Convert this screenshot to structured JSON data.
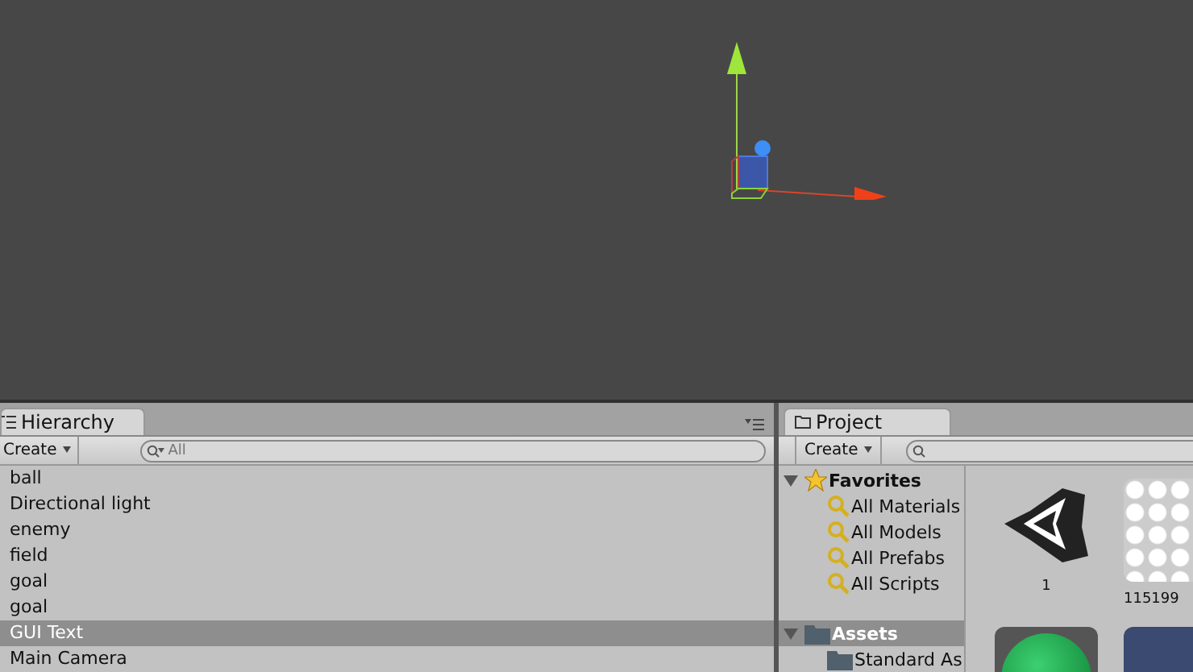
{
  "hierarchy": {
    "tab": "Hierarchy",
    "create": "Create",
    "search": {
      "placeholder": "All"
    },
    "rows": [
      {
        "label": "ball",
        "selected": false
      },
      {
        "label": "Directional light",
        "selected": false
      },
      {
        "label": "enemy",
        "selected": false
      },
      {
        "label": "field",
        "selected": false
      },
      {
        "label": "goal",
        "selected": false
      },
      {
        "label": "goal",
        "selected": false
      },
      {
        "label": "GUI Text",
        "selected": true
      },
      {
        "label": "Main Camera",
        "selected": false
      }
    ]
  },
  "project": {
    "tab": "Project",
    "create": "Create",
    "tree": [
      {
        "label": "Favorites",
        "kind": "star",
        "expanded": true,
        "selected": false,
        "children": [
          {
            "label": "All Materials",
            "kind": "search",
            "selected": false
          },
          {
            "label": "All Models",
            "kind": "search",
            "selected": false
          },
          {
            "label": "All Prefabs",
            "kind": "search",
            "selected": false
          },
          {
            "label": "All Scripts",
            "kind": "search",
            "selected": false
          }
        ]
      },
      {
        "label": "Assets",
        "kind": "folder",
        "expanded": true,
        "selected": true,
        "children": [
          {
            "label": "Standard As",
            "kind": "folder",
            "selected": false
          }
        ]
      }
    ],
    "assets": [
      {
        "kind": "logo",
        "label": "1"
      },
      {
        "kind": "texture",
        "label": "115199"
      },
      {
        "kind": "sphere"
      },
      {
        "kind": "mesh"
      }
    ]
  }
}
